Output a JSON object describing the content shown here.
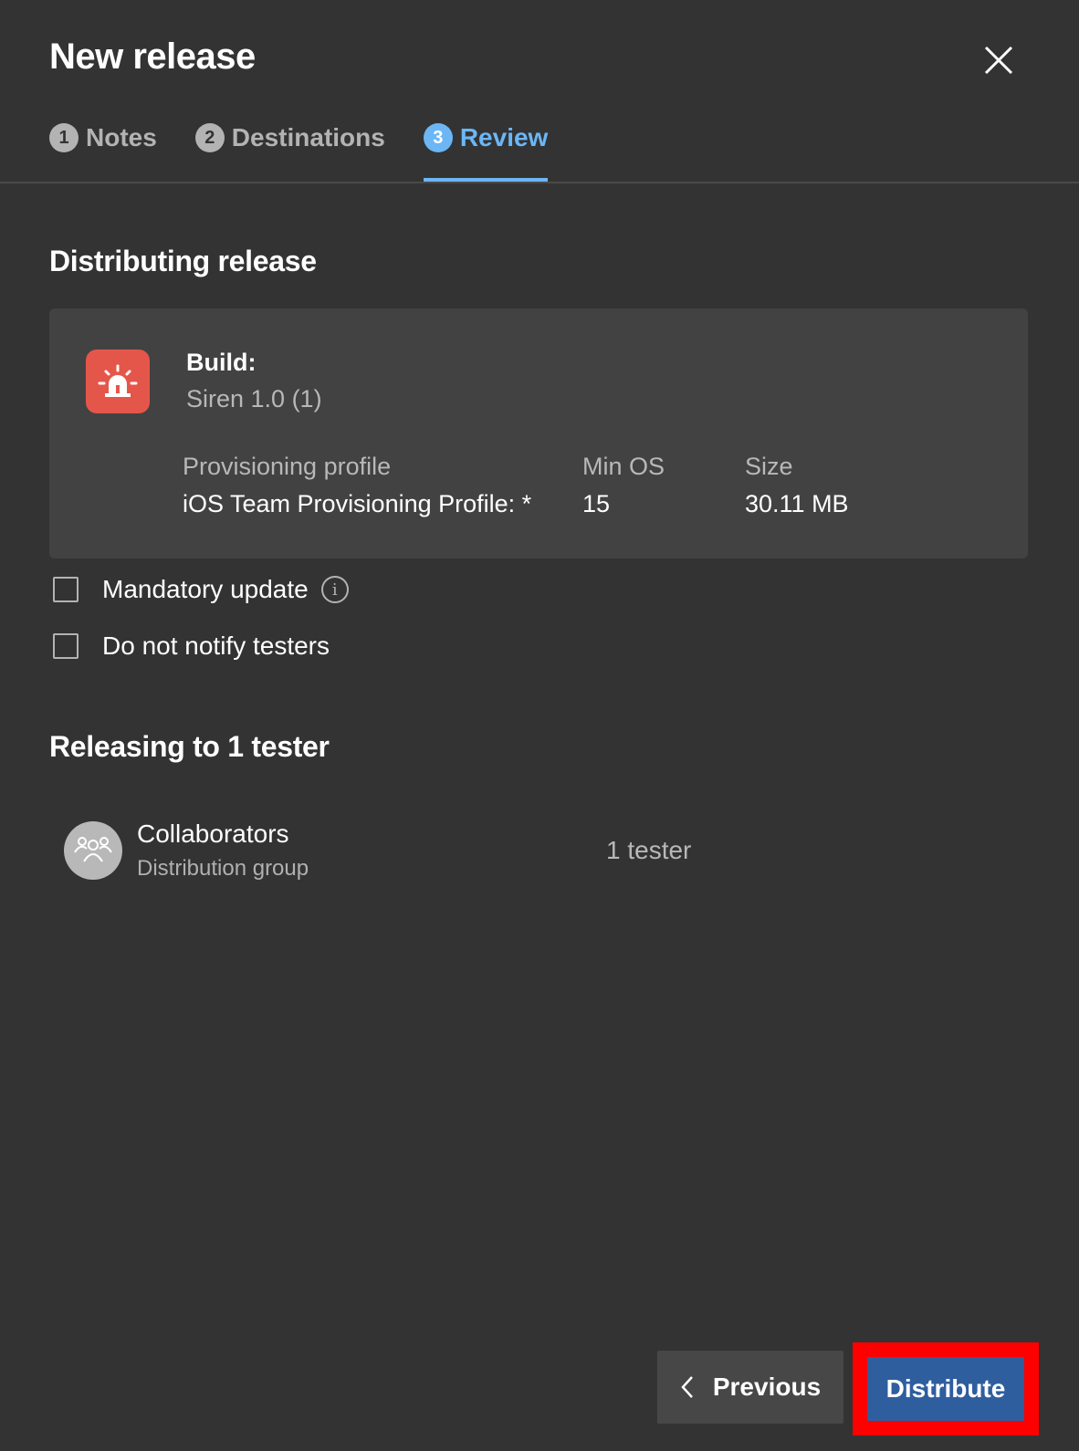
{
  "dialog": {
    "title": "New release"
  },
  "tabs": [
    {
      "num": "1",
      "label": "Notes"
    },
    {
      "num": "2",
      "label": "Destinations"
    },
    {
      "num": "3",
      "label": "Review"
    }
  ],
  "distributing": {
    "heading": "Distributing release",
    "build_label": "Build:",
    "build_value": "Siren 1.0 (1)",
    "provisioning_label": "Provisioning profile",
    "provisioning_value": "iOS Team Provisioning Profile: *",
    "min_os_label": "Min OS",
    "min_os_value": "15",
    "size_label": "Size",
    "size_value": "30.11 MB",
    "app_icon": "siren-icon",
    "app_icon_color": "#e5564a"
  },
  "options": {
    "mandatory_label": "Mandatory update",
    "notify_label": "Do not notify testers"
  },
  "releasing": {
    "heading": "Releasing to 1 tester",
    "group_name": "Collaborators",
    "group_type": "Distribution group",
    "group_count": "1 tester"
  },
  "footer": {
    "previous_label": "Previous",
    "distribute_label": "Distribute"
  },
  "colors": {
    "background": "#333333",
    "active_tab": "#6cb6f5",
    "primary_button": "#2f5e9f",
    "highlight_frame": "#ff0000"
  }
}
